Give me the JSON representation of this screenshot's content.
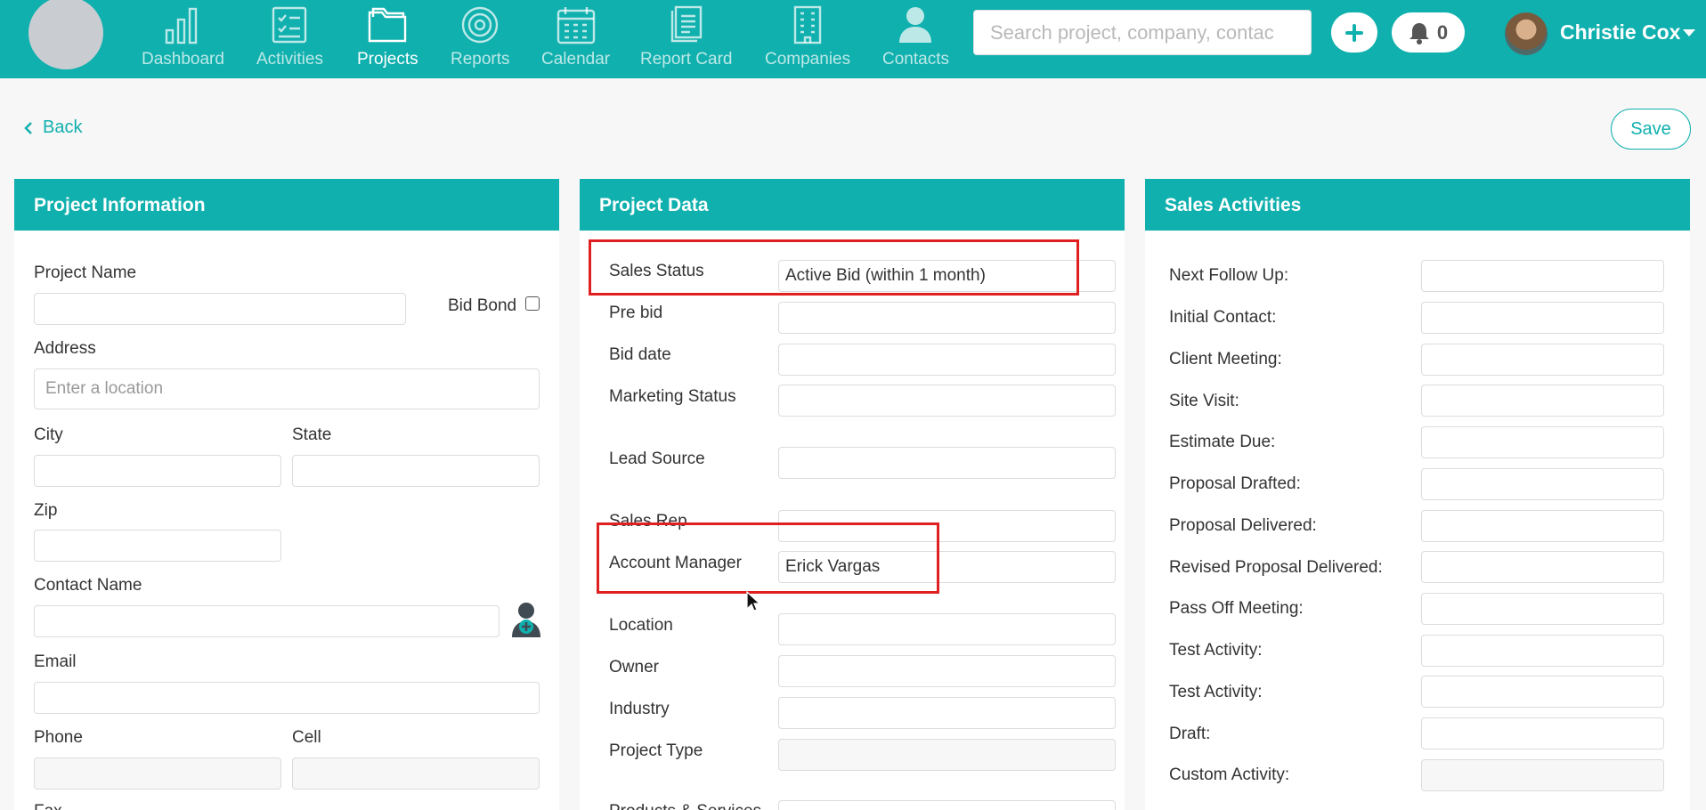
{
  "nav": {
    "items": [
      {
        "label": "Dashboard",
        "icon": "bar-chart-icon"
      },
      {
        "label": "Activities",
        "icon": "checklist-icon"
      },
      {
        "label": "Projects",
        "icon": "folder-icon"
      },
      {
        "label": "Reports",
        "icon": "target-icon"
      },
      {
        "label": "Calendar",
        "icon": "calendar-icon"
      },
      {
        "label": "Report Card",
        "icon": "documents-icon"
      },
      {
        "label": "Companies",
        "icon": "building-icon"
      },
      {
        "label": "Contacts",
        "icon": "person-icon"
      }
    ],
    "active": "Projects",
    "search_placeholder": "Search project, company, contac",
    "notification_count": "0",
    "user_name": "Christie Cox"
  },
  "toolbar": {
    "back_label": "Back",
    "save_label": "Save"
  },
  "project_information": {
    "title": "Project Information",
    "project_name_label": "Project Name",
    "bid_bond_label": "Bid Bond",
    "address_label": "Address",
    "address_placeholder": "Enter a location",
    "city_label": "City",
    "state_label": "State",
    "zip_label": "Zip",
    "contact_name_label": "Contact Name",
    "email_label": "Email",
    "phone_label": "Phone",
    "cell_label": "Cell",
    "fax_label": "Fax"
  },
  "project_data": {
    "title": "Project Data",
    "fields": [
      {
        "label": "Sales Status",
        "value": "Active Bid (within 1 month)"
      },
      {
        "label": "Pre bid",
        "value": ""
      },
      {
        "label": "Bid date",
        "value": ""
      },
      {
        "label": "Marketing Status",
        "value": ""
      },
      {
        "label": "Lead Source",
        "value": ""
      },
      {
        "label": "Sales Rep",
        "value": ""
      },
      {
        "label": "Account Manager",
        "value": "Erick Vargas"
      },
      {
        "label": "Location",
        "value": ""
      },
      {
        "label": "Owner",
        "value": ""
      },
      {
        "label": "Industry",
        "value": ""
      },
      {
        "label": "Project Type",
        "value": ""
      },
      {
        "label": "Products & Services",
        "value": ""
      }
    ]
  },
  "sales_activities": {
    "title": "Sales Activities",
    "fields": [
      {
        "label": "Next Follow Up:",
        "value": ""
      },
      {
        "label": "Initial Contact:",
        "value": ""
      },
      {
        "label": "Client Meeting:",
        "value": ""
      },
      {
        "label": "Site Visit:",
        "value": ""
      },
      {
        "label": "Estimate Due:",
        "value": ""
      },
      {
        "label": "Proposal Drafted:",
        "value": ""
      },
      {
        "label": "Proposal Delivered:",
        "value": ""
      },
      {
        "label": "Revised Proposal Delivered:",
        "value": ""
      },
      {
        "label": "Pass Off Meeting:",
        "value": ""
      },
      {
        "label": "Test Activity:",
        "value": ""
      },
      {
        "label": "Test Activity:",
        "value": ""
      },
      {
        "label": "Draft:",
        "value": ""
      },
      {
        "label": "Custom Activity:",
        "value": ""
      }
    ]
  },
  "colors": {
    "accent": "#10b0ae",
    "highlight": "#e02020"
  }
}
